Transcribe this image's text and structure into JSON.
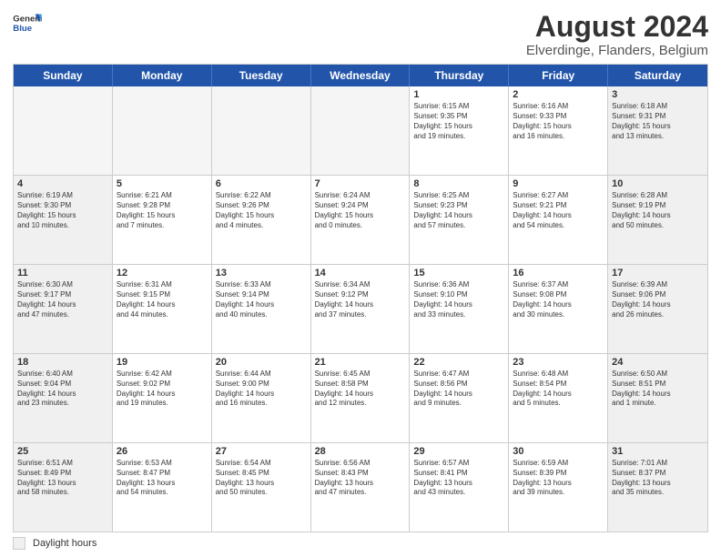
{
  "header": {
    "logo_general": "General",
    "logo_blue": "Blue",
    "month_year": "August 2024",
    "location": "Elverdinge, Flanders, Belgium"
  },
  "days_of_week": [
    "Sunday",
    "Monday",
    "Tuesday",
    "Wednesday",
    "Thursday",
    "Friday",
    "Saturday"
  ],
  "footer": {
    "label": "Daylight hours"
  },
  "weeks": [
    [
      {
        "day": "",
        "empty": true
      },
      {
        "day": "",
        "empty": true
      },
      {
        "day": "",
        "empty": true
      },
      {
        "day": "",
        "empty": true
      },
      {
        "day": "1",
        "lines": [
          "Sunrise: 6:15 AM",
          "Sunset: 9:35 PM",
          "Daylight: 15 hours",
          "and 19 minutes."
        ]
      },
      {
        "day": "2",
        "lines": [
          "Sunrise: 6:16 AM",
          "Sunset: 9:33 PM",
          "Daylight: 15 hours",
          "and 16 minutes."
        ]
      },
      {
        "day": "3",
        "lines": [
          "Sunrise: 6:18 AM",
          "Sunset: 9:31 PM",
          "Daylight: 15 hours",
          "and 13 minutes."
        ]
      }
    ],
    [
      {
        "day": "4",
        "lines": [
          "Sunrise: 6:19 AM",
          "Sunset: 9:30 PM",
          "Daylight: 15 hours",
          "and 10 minutes."
        ]
      },
      {
        "day": "5",
        "lines": [
          "Sunrise: 6:21 AM",
          "Sunset: 9:28 PM",
          "Daylight: 15 hours",
          "and 7 minutes."
        ]
      },
      {
        "day": "6",
        "lines": [
          "Sunrise: 6:22 AM",
          "Sunset: 9:26 PM",
          "Daylight: 15 hours",
          "and 4 minutes."
        ]
      },
      {
        "day": "7",
        "lines": [
          "Sunrise: 6:24 AM",
          "Sunset: 9:24 PM",
          "Daylight: 15 hours",
          "and 0 minutes."
        ]
      },
      {
        "day": "8",
        "lines": [
          "Sunrise: 6:25 AM",
          "Sunset: 9:23 PM",
          "Daylight: 14 hours",
          "and 57 minutes."
        ]
      },
      {
        "day": "9",
        "lines": [
          "Sunrise: 6:27 AM",
          "Sunset: 9:21 PM",
          "Daylight: 14 hours",
          "and 54 minutes."
        ]
      },
      {
        "day": "10",
        "lines": [
          "Sunrise: 6:28 AM",
          "Sunset: 9:19 PM",
          "Daylight: 14 hours",
          "and 50 minutes."
        ]
      }
    ],
    [
      {
        "day": "11",
        "lines": [
          "Sunrise: 6:30 AM",
          "Sunset: 9:17 PM",
          "Daylight: 14 hours",
          "and 47 minutes."
        ]
      },
      {
        "day": "12",
        "lines": [
          "Sunrise: 6:31 AM",
          "Sunset: 9:15 PM",
          "Daylight: 14 hours",
          "and 44 minutes."
        ]
      },
      {
        "day": "13",
        "lines": [
          "Sunrise: 6:33 AM",
          "Sunset: 9:14 PM",
          "Daylight: 14 hours",
          "and 40 minutes."
        ]
      },
      {
        "day": "14",
        "lines": [
          "Sunrise: 6:34 AM",
          "Sunset: 9:12 PM",
          "Daylight: 14 hours",
          "and 37 minutes."
        ]
      },
      {
        "day": "15",
        "lines": [
          "Sunrise: 6:36 AM",
          "Sunset: 9:10 PM",
          "Daylight: 14 hours",
          "and 33 minutes."
        ]
      },
      {
        "day": "16",
        "lines": [
          "Sunrise: 6:37 AM",
          "Sunset: 9:08 PM",
          "Daylight: 14 hours",
          "and 30 minutes."
        ]
      },
      {
        "day": "17",
        "lines": [
          "Sunrise: 6:39 AM",
          "Sunset: 9:06 PM",
          "Daylight: 14 hours",
          "and 26 minutes."
        ]
      }
    ],
    [
      {
        "day": "18",
        "lines": [
          "Sunrise: 6:40 AM",
          "Sunset: 9:04 PM",
          "Daylight: 14 hours",
          "and 23 minutes."
        ]
      },
      {
        "day": "19",
        "lines": [
          "Sunrise: 6:42 AM",
          "Sunset: 9:02 PM",
          "Daylight: 14 hours",
          "and 19 minutes."
        ]
      },
      {
        "day": "20",
        "lines": [
          "Sunrise: 6:44 AM",
          "Sunset: 9:00 PM",
          "Daylight: 14 hours",
          "and 16 minutes."
        ]
      },
      {
        "day": "21",
        "lines": [
          "Sunrise: 6:45 AM",
          "Sunset: 8:58 PM",
          "Daylight: 14 hours",
          "and 12 minutes."
        ]
      },
      {
        "day": "22",
        "lines": [
          "Sunrise: 6:47 AM",
          "Sunset: 8:56 PM",
          "Daylight: 14 hours",
          "and 9 minutes."
        ]
      },
      {
        "day": "23",
        "lines": [
          "Sunrise: 6:48 AM",
          "Sunset: 8:54 PM",
          "Daylight: 14 hours",
          "and 5 minutes."
        ]
      },
      {
        "day": "24",
        "lines": [
          "Sunrise: 6:50 AM",
          "Sunset: 8:51 PM",
          "Daylight: 14 hours",
          "and 1 minute."
        ]
      }
    ],
    [
      {
        "day": "25",
        "lines": [
          "Sunrise: 6:51 AM",
          "Sunset: 8:49 PM",
          "Daylight: 13 hours",
          "and 58 minutes."
        ]
      },
      {
        "day": "26",
        "lines": [
          "Sunrise: 6:53 AM",
          "Sunset: 8:47 PM",
          "Daylight: 13 hours",
          "and 54 minutes."
        ]
      },
      {
        "day": "27",
        "lines": [
          "Sunrise: 6:54 AM",
          "Sunset: 8:45 PM",
          "Daylight: 13 hours",
          "and 50 minutes."
        ]
      },
      {
        "day": "28",
        "lines": [
          "Sunrise: 6:56 AM",
          "Sunset: 8:43 PM",
          "Daylight: 13 hours",
          "and 47 minutes."
        ]
      },
      {
        "day": "29",
        "lines": [
          "Sunrise: 6:57 AM",
          "Sunset: 8:41 PM",
          "Daylight: 13 hours",
          "and 43 minutes."
        ]
      },
      {
        "day": "30",
        "lines": [
          "Sunrise: 6:59 AM",
          "Sunset: 8:39 PM",
          "Daylight: 13 hours",
          "and 39 minutes."
        ]
      },
      {
        "day": "31",
        "lines": [
          "Sunrise: 7:01 AM",
          "Sunset: 8:37 PM",
          "Daylight: 13 hours",
          "and 35 minutes."
        ]
      }
    ]
  ]
}
